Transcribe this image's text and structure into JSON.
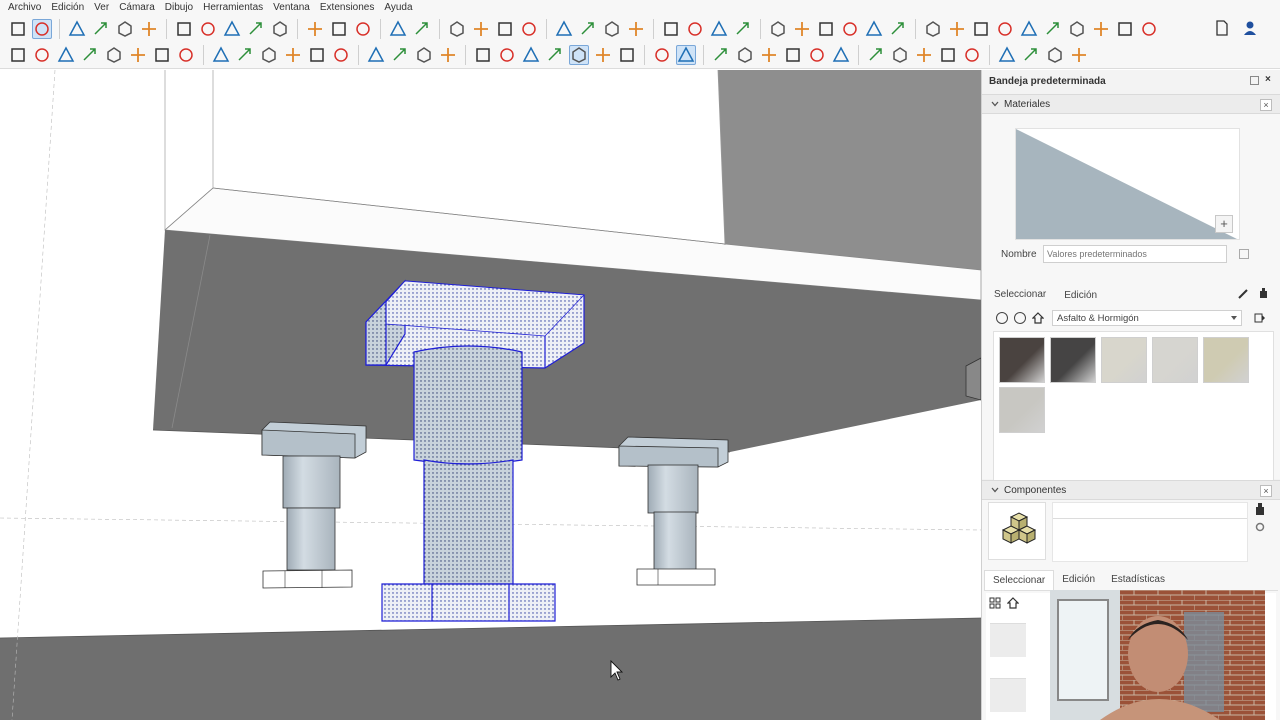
{
  "menu": [
    "Archivo",
    "Edición",
    "Ver",
    "Cámara",
    "Dibujo",
    "Herramientas",
    "Ventana",
    "Extensiones",
    "Ayuda"
  ],
  "toolbar1_icons": [
    "zoom-icon",
    "select-icon",
    "eraser-icon",
    "pencil-icon",
    "arc-icon",
    "rectangle-icon",
    "push-pull-icon",
    "follow-me-icon",
    "move-icon",
    "rotate-icon",
    "scale-icon",
    "offset-icon",
    "paint-bucket-icon",
    "tape-measure-icon",
    "orbit-icon",
    "pan-icon",
    "zoom-extents-icon",
    "sandbox-icon",
    "sandbox-smoove-icon",
    "sandbox-stamp-icon",
    "sandbox-drape-icon",
    "section-icon",
    "warehouse-icon",
    "extension-icon",
    "solid-union-icon",
    "solid-subtract-icon",
    "solid-trim-icon",
    "solid-split-icon",
    "camera-position-icon",
    "walk-icon",
    "look-around-icon",
    "styles-icon",
    "shadows-icon",
    "fog-icon",
    "view-iso-icon",
    "view-top-icon",
    "view-front-icon",
    "view-right-icon",
    "view-back-icon",
    "view-left-icon",
    "x-ray-icon",
    "back-edges-icon",
    "wireframe-icon",
    "hidden-line-icon"
  ],
  "toolbar1_right_icons": [
    "new-file-icon",
    "account-icon"
  ],
  "toolbar2_icons": [
    "layers-icon",
    "outliner-icon",
    "box-icon",
    "cube-icon",
    "wire-cube-icon",
    "sphere-icon",
    "globe-icon",
    "hand-icon",
    "camera-icon",
    "cylinder-icon",
    "cone-icon",
    "shape-icon",
    "stairs-icon",
    "grid-icon",
    "array-icon",
    "copy-icon",
    "frame-icon",
    "gear-icon",
    "cross-icon",
    "drop-icon",
    "drop-fill-icon",
    "drop-blue-icon",
    "drop-active-icon",
    "drop-outline-icon",
    "scissors-icon",
    "magnet-icon",
    "magnet-active-icon",
    "plus-circle-icon",
    "line-icon",
    "hex-icon",
    "hex2-icon",
    "hex3-icon",
    "hex4-icon",
    "spark-icon",
    "spin-icon",
    "mesh-icon",
    "mesh2-icon",
    "mesh3-icon",
    "dcl-icon",
    "curve-icon",
    "tripod-icon",
    "export-icon"
  ],
  "tray": {
    "title": "Bandeja predeterminada",
    "materials": {
      "heading": "Materiales",
      "name_label": "Nombre",
      "name_placeholder": "Valores predeterminados",
      "tabs": [
        "Seleccionar",
        "Edición"
      ],
      "library": "Asfalto & Hormigón",
      "swatch_colors": [
        "#4a4340",
        "#454444",
        "#d8d6cc",
        "#d6d5d0",
        "#cfcbb2",
        "#c8c7c2"
      ]
    },
    "components": {
      "heading": "Componentes",
      "tabs": [
        "Seleccionar",
        "Edición",
        "Estadísticas"
      ]
    }
  },
  "colors": {
    "selection": "#1f1fd6",
    "column": "#c7d2da",
    "dark_face": "#6f6f6f"
  }
}
